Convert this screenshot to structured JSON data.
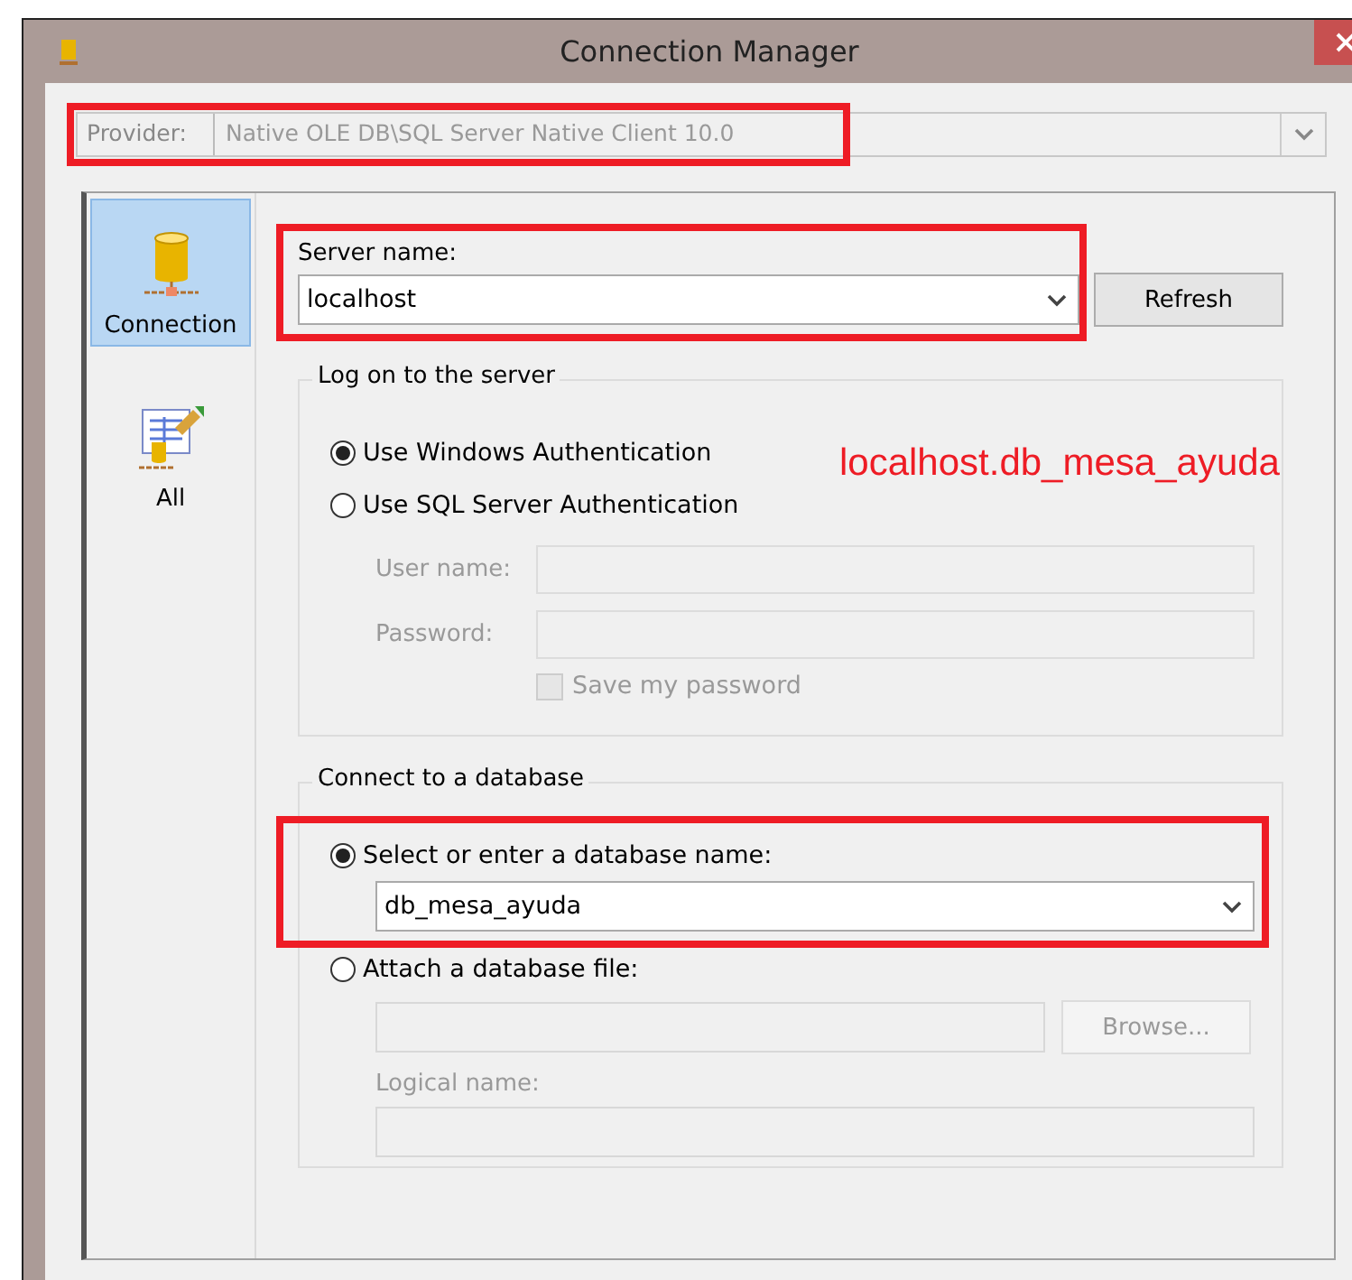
{
  "window": {
    "title": "Connection Manager"
  },
  "provider": {
    "label": "Provider:",
    "value": "Native OLE DB\\SQL Server Native Client 10.0",
    "disabled": true,
    "highlighted": true
  },
  "sidebar": {
    "items": [
      {
        "label": "Connection",
        "kind": "connection",
        "selected": true
      },
      {
        "label": "All",
        "kind": "all",
        "selected": false
      }
    ]
  },
  "server": {
    "label": "Server name:",
    "value": "localhost",
    "highlighted": true,
    "button": "Refresh"
  },
  "logon": {
    "legend": "Log on to the server",
    "options": [
      {
        "label": "Use Windows Authentication",
        "selected": true
      },
      {
        "label": "Use SQL Server Authentication",
        "selected": false
      }
    ],
    "fields": [
      {
        "label": "User name:",
        "disabled": true
      },
      {
        "label": "Password:",
        "disabled": true
      }
    ],
    "save_password": {
      "label": "Save my password",
      "checked": false,
      "disabled": true
    }
  },
  "annotation": "localhost.db_mesa_ayuda",
  "database": {
    "legend": "Connect to a database",
    "options": [
      {
        "label": "Select or enter a database name:",
        "selected": true,
        "value": "db_mesa_ayuda",
        "highlighted": true
      },
      {
        "label": "Attach a database file:",
        "selected": false
      }
    ],
    "attach": {
      "button": "Browse...",
      "logical_label": "Logical name:",
      "disabled": true
    }
  }
}
